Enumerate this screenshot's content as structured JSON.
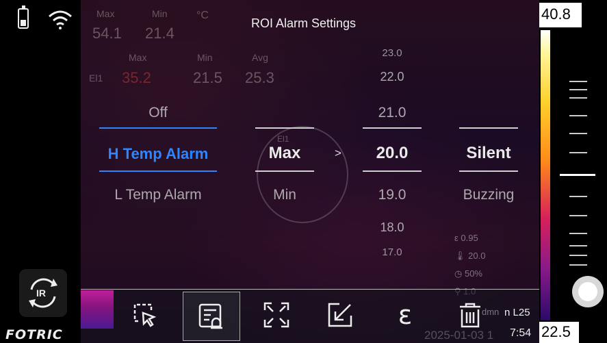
{
  "title": "ROI Alarm Settings",
  "status": {
    "battery": "battery-icon",
    "wifi": "wifi-icon"
  },
  "background_readings": {
    "max_label": "Max",
    "min_label": "Min",
    "unit": "°C",
    "max_value": "54.1",
    "min_value": "21.4",
    "roi_max_label": "Max",
    "roi_min_label": "Min",
    "roi_avg_label": "Avg",
    "roi_name": "El1",
    "roi_max": "35.2",
    "roi_min": "21.5",
    "roi_avg": "25.3",
    "roi_label_center": "El1"
  },
  "picker_mode": {
    "above": "Off",
    "selected": "H Temp Alarm",
    "below": "L Temp Alarm"
  },
  "picker_stat": {
    "selected": "Max",
    "below": "Min"
  },
  "comparator": ">",
  "picker_temp": {
    "above3": "23.0",
    "above2": "22.0",
    "above1": "21.0",
    "selected": "20.0",
    "below1": "19.0",
    "below2": "18.0",
    "below3": "17.0"
  },
  "picker_sound": {
    "selected": "Silent",
    "below": "Buzzing"
  },
  "params": {
    "emissivity": "0.95",
    "ref_temp": "20.0",
    "humidity": "50%",
    "distance": "1.0",
    "distance_unit": "dmn"
  },
  "scale": {
    "max": "40.8",
    "min": "22.5"
  },
  "footer": {
    "level": "n L25",
    "time": "7:54",
    "date": "2025-01-03  1"
  },
  "logo": "FOTRIC",
  "ir_label": "IR",
  "toolbar": [
    "select-roi",
    "roi-alarm-settings",
    "fullscreen",
    "export",
    "emissivity",
    "delete"
  ]
}
